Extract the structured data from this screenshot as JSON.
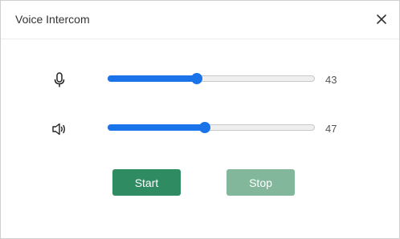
{
  "dialog": {
    "title": "Voice Intercom",
    "close_icon": "close-icon"
  },
  "controls": {
    "microphone": {
      "icon": "microphone-icon",
      "value": 43,
      "max": 100
    },
    "speaker": {
      "icon": "speaker-icon",
      "value": 47,
      "max": 100
    }
  },
  "buttons": {
    "start_label": "Start",
    "stop_label": "Stop"
  },
  "colors": {
    "accent": "#1a73e8",
    "start_button": "#2e8b62",
    "stop_button_disabled": "#82b79b"
  }
}
